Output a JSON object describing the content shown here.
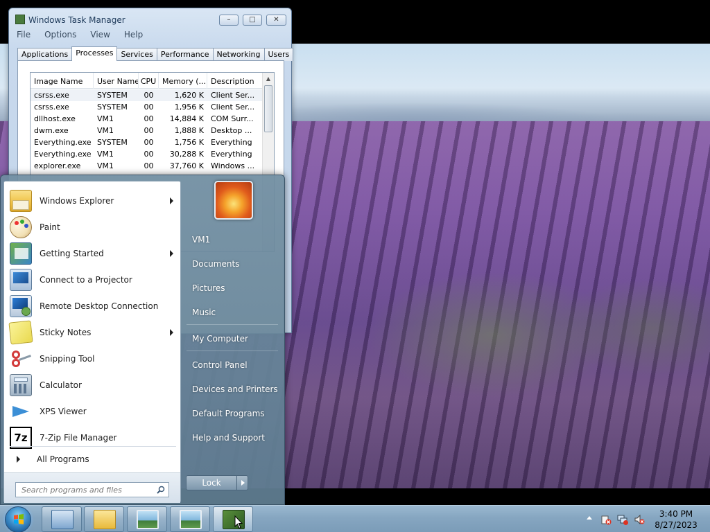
{
  "task_manager": {
    "title": "Windows Task Manager",
    "menu": [
      "File",
      "Options",
      "View",
      "Help"
    ],
    "tabs": [
      "Applications",
      "Processes",
      "Services",
      "Performance",
      "Networking",
      "Users"
    ],
    "active_tab": "Processes",
    "columns": [
      "Image Name",
      "User Name",
      "CPU",
      "Memory (...",
      "Description"
    ],
    "rows": [
      {
        "image": "csrss.exe",
        "user": "SYSTEM",
        "cpu": "00",
        "memory": "1,620 K",
        "desc": "Client Ser..."
      },
      {
        "image": "csrss.exe",
        "user": "SYSTEM",
        "cpu": "00",
        "memory": "1,956 K",
        "desc": "Client Ser..."
      },
      {
        "image": "dllhost.exe",
        "user": "VM1",
        "cpu": "00",
        "memory": "14,884 K",
        "desc": "COM Surr..."
      },
      {
        "image": "dwm.exe",
        "user": "VM1",
        "cpu": "00",
        "memory": "1,888 K",
        "desc": "Desktop ..."
      },
      {
        "image": "Everything.exe",
        "user": "SYSTEM",
        "cpu": "00",
        "memory": "1,756 K",
        "desc": "Everything"
      },
      {
        "image": "Everything.exe",
        "user": "VM1",
        "cpu": "00",
        "memory": "30,288 K",
        "desc": "Everything"
      },
      {
        "image": "explorer.exe",
        "user": "VM1",
        "cpu": "00",
        "memory": "37,760 K",
        "desc": "Windows ..."
      }
    ]
  },
  "start_menu": {
    "programs": [
      {
        "label": "Windows Explorer",
        "icon": "folder-icon",
        "has_submenu": true
      },
      {
        "label": "Paint",
        "icon": "paint-palette-icon",
        "has_submenu": false
      },
      {
        "label": "Getting Started",
        "icon": "getting-started-icon",
        "has_submenu": true
      },
      {
        "label": "Connect to a Projector",
        "icon": "projector-icon",
        "has_submenu": false
      },
      {
        "label": "Remote Desktop Connection",
        "icon": "remote-desktop-icon",
        "has_submenu": false
      },
      {
        "label": "Sticky Notes",
        "icon": "sticky-notes-icon",
        "has_submenu": true
      },
      {
        "label": "Snipping Tool",
        "icon": "scissors-icon",
        "has_submenu": false
      },
      {
        "label": "Calculator",
        "icon": "calculator-icon",
        "has_submenu": false
      },
      {
        "label": "XPS Viewer",
        "icon": "xps-viewer-icon",
        "has_submenu": false
      },
      {
        "label": "7-Zip File Manager",
        "icon": "7zip-icon",
        "has_submenu": false
      }
    ],
    "all_programs": "All Programs",
    "search_placeholder": "Search programs and files",
    "right_links": {
      "user": "VM1",
      "documents": "Documents",
      "pictures": "Pictures",
      "music": "Music",
      "computer": "My Computer",
      "control_panel": "Control Panel",
      "devices": "Devices and Printers",
      "default_programs": "Default Programs",
      "help": "Help and Support"
    },
    "lock_label": "Lock"
  },
  "taskbar": {
    "buttons": [
      "task-manager-app",
      "windows-explorer-app",
      "photo-viewer-app",
      "photo-viewer-app-2",
      "task-manager-active-app"
    ],
    "tray_icons": [
      "action-center-alert-icon",
      "network-disconnected-icon",
      "volume-muted-icon"
    ],
    "clock_time": "3:40 PM",
    "clock_date": "8/27/2023"
  }
}
